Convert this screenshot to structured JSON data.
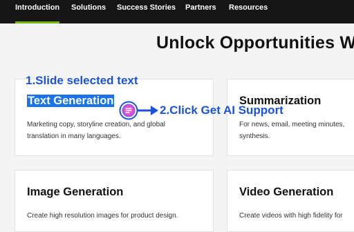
{
  "nav": {
    "tabs": [
      {
        "label": "Introduction",
        "active": true
      },
      {
        "label": "Solutions"
      },
      {
        "label": "Success Stories"
      },
      {
        "label": "Partners"
      },
      {
        "label": "Resources"
      }
    ]
  },
  "main": {
    "heading": "Unlock Opportunities W"
  },
  "cards": [
    {
      "title": "Text Generation",
      "desc_lines": [
        "Marketing copy, storyline creation, and global",
        "translation in many languages."
      ]
    },
    {
      "title": "Summarization",
      "desc_lines": [
        "For news, email, meeting minutes,",
        "synthesis."
      ]
    },
    {
      "title": "Image Generation",
      "desc_lines": [
        "Create high resolution images for product design."
      ]
    },
    {
      "title": "Video Generation",
      "desc_lines": [
        "Create videos with high fidelity for"
      ]
    }
  ],
  "annotations": {
    "step1": "1.Slide selected text",
    "step2": "2.Click Get AI Support"
  },
  "icons": {
    "ai_support": "ai-support-icon",
    "arrow": "arrow-right-icon"
  },
  "colors": {
    "nav_bg": "#161616",
    "nav_active_underline": "#76b900",
    "selection": "#1a73e8",
    "annotation": "#1a52d8"
  }
}
